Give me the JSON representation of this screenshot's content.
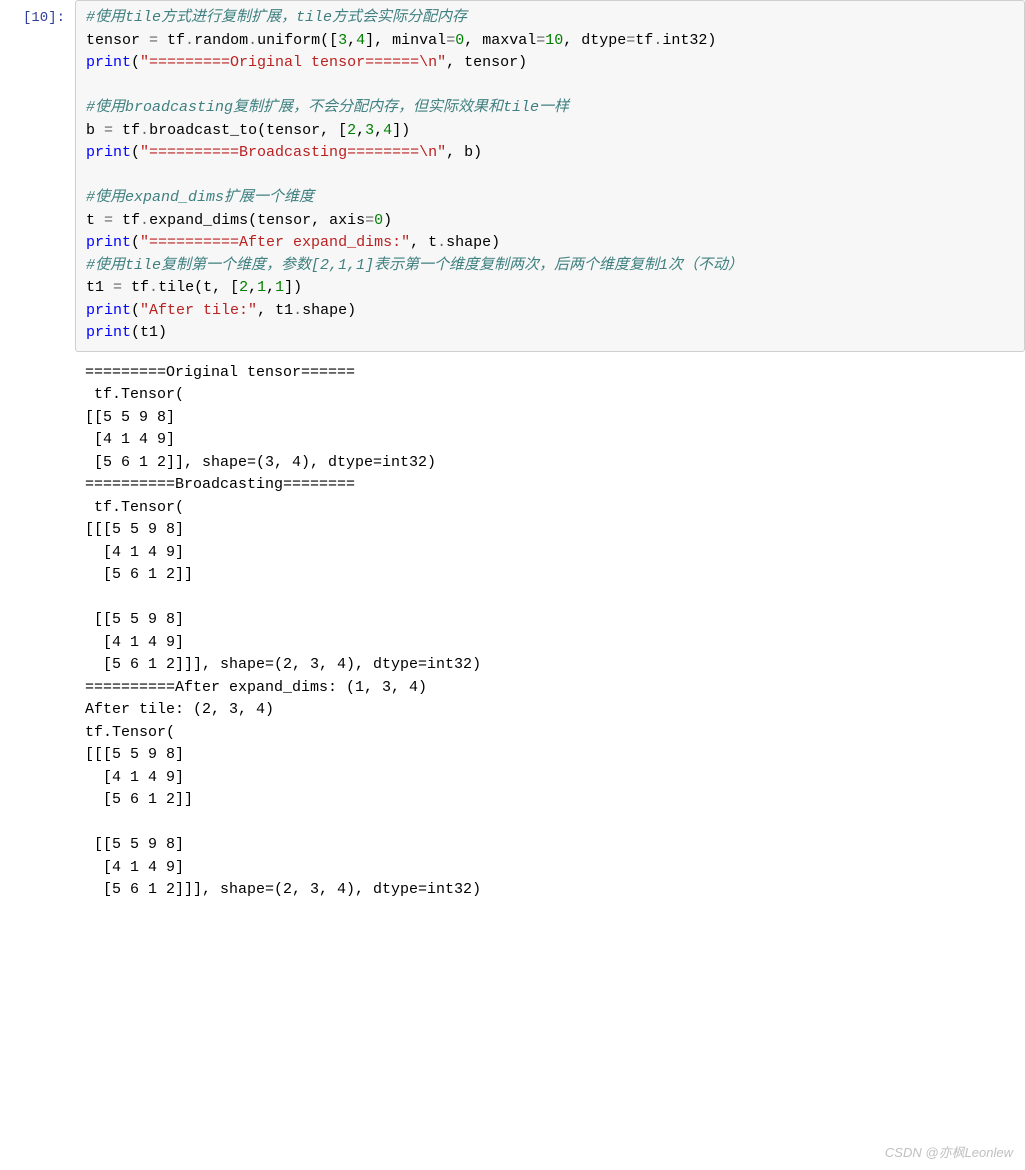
{
  "prompt": "[10]:",
  "code": {
    "c1": "#使用tile方式进行复制扩展，tile方式会实际分配内存",
    "l2_a": "tensor ",
    "l2_b": " tf",
    "l2_c": "random",
    "l2_d": "uniform",
    "l2_e": "([",
    "l2_n1": "3",
    "l2_comma1": ",",
    "l2_n2": "4",
    "l2_f": "], minval",
    "l2_eq2": "=",
    "l2_n3": "0",
    "l2_g": ", maxval",
    "l2_eq3": "=",
    "l2_n4": "10",
    "l2_h": ", dtype",
    "l2_eq4": "=",
    "l2_i": "tf",
    "l2_j": "int32",
    "l2_k": ")",
    "l3_a": "print",
    "l3_b": "(",
    "l3_s": "\"=========Original tensor======\\n\"",
    "l3_c": ", tensor)",
    "blank1": "",
    "c2": "#使用broadcasting复制扩展，不会分配内存，但实际效果和tile一样",
    "l6_a": "b ",
    "l6_eq": "=",
    "l6_b": " tf",
    "l6_c": "broadcast_to",
    "l6_d": "(tensor, [",
    "l6_n1": "2",
    "l6_cm1": ",",
    "l6_n2": "3",
    "l6_cm2": ",",
    "l6_n3": "4",
    "l6_e": "])",
    "l7_a": "print",
    "l7_b": "(",
    "l7_s": "\"==========Broadcasting========\\n\"",
    "l7_c": ", b)",
    "blank2": "",
    "c3": "#使用expand_dims扩展一个维度",
    "l10_a": "t ",
    "l10_eq": "=",
    "l10_b": " tf",
    "l10_c": "expand_dims",
    "l10_d": "(tensor, axis",
    "l10_eq2": "=",
    "l10_n": "0",
    "l10_e": ")",
    "l11_a": "print",
    "l11_b": "(",
    "l11_s": "\"==========After expand_dims:\"",
    "l11_c": ", t",
    "l11_d": "shape",
    "l11_e": ")",
    "c4": "#使用tile复制第一个维度，参数[2,1,1]表示第一个维度复制两次，后两个维度复制1次（不动）",
    "l13_a": "t1 ",
    "l13_eq": "=",
    "l13_b": " tf",
    "l13_c": "tile",
    "l13_d": "(t, [",
    "l13_n1": "2",
    "l13_cm1": ",",
    "l13_n2": "1",
    "l13_cm2": ",",
    "l13_n3": "1",
    "l13_e": "])",
    "l14_a": "print",
    "l14_b": "(",
    "l14_s": "\"After tile:\"",
    "l14_c": ", t1",
    "l14_d": "shape",
    "l14_e": ")",
    "l15_a": "print",
    "l15_b": "(t1)"
  },
  "output": "=========Original tensor======\n tf.Tensor(\n[[5 5 9 8]\n [4 1 4 9]\n [5 6 1 2]], shape=(3, 4), dtype=int32)\n==========Broadcasting========\n tf.Tensor(\n[[[5 5 9 8]\n  [4 1 4 9]\n  [5 6 1 2]]\n\n [[5 5 9 8]\n  [4 1 4 9]\n  [5 6 1 2]]], shape=(2, 3, 4), dtype=int32)\n==========After expand_dims: (1, 3, 4)\nAfter tile: (2, 3, 4)\ntf.Tensor(\n[[[5 5 9 8]\n  [4 1 4 9]\n  [5 6 1 2]]\n\n [[5 5 9 8]\n  [4 1 4 9]\n  [5 6 1 2]]], shape=(2, 3, 4), dtype=int32)",
  "watermark": "CSDN @亦枫Leonlew"
}
